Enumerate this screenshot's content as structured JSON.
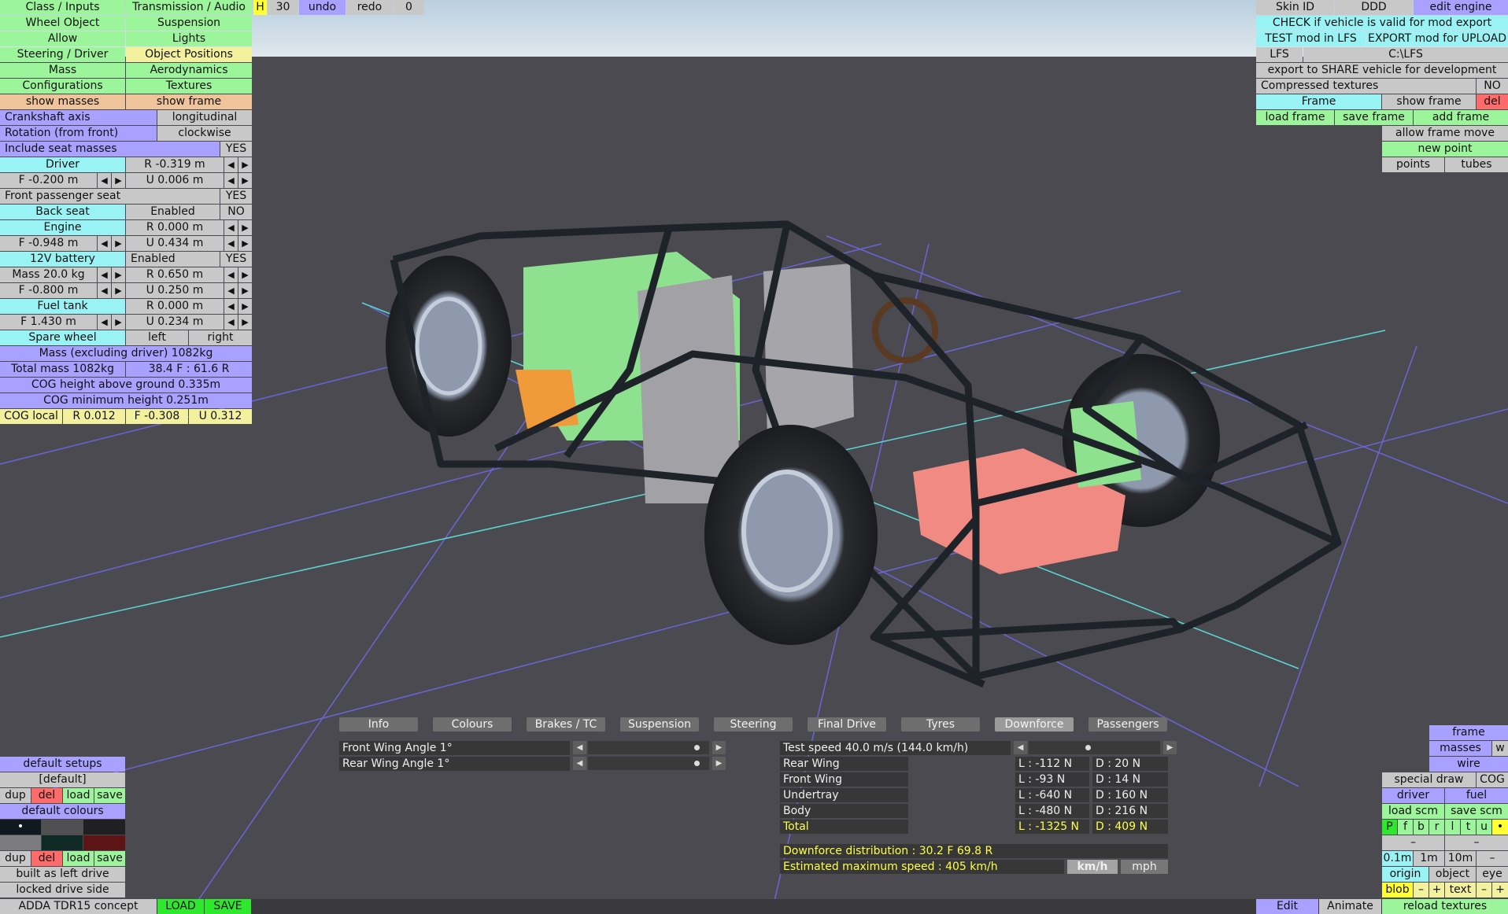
{
  "left_panel": {
    "nav": [
      "Class / Inputs",
      "Transmission / Audio",
      "Wheel Object",
      "Suspension",
      "Allow",
      "Lights",
      "Steering / Driver",
      "Object Positions",
      "Mass",
      "Aerodynamics",
      "Configurations",
      "Textures",
      "show masses",
      "show frame"
    ],
    "crankshaft_label": "Crankshaft axis",
    "crankshaft_value": "longitudinal",
    "rotation_label": "Rotation (from front)",
    "rotation_value": "clockwise",
    "seat_masses_label": "Include seat masses",
    "seat_masses_value": "YES",
    "driver_label": "Driver",
    "driver_r": "R -0.319 m",
    "driver_f": "F -0.200 m",
    "driver_u": "U 0.006 m",
    "front_passenger_label": "Front passenger seat",
    "front_passenger_value": "YES",
    "back_seat_label": "Back seat",
    "back_seat_state": "Enabled",
    "back_seat_value": "NO",
    "engine_label": "Engine",
    "engine_r": "R 0.000 m",
    "engine_f": "F -0.948 m",
    "engine_u": "U 0.434 m",
    "battery_label": "12V battery",
    "battery_state": "Enabled",
    "battery_value": "YES",
    "battery_mass": "Mass 20.0 kg",
    "battery_r": "R 0.650 m",
    "battery_f": "F -0.800 m",
    "battery_u": "U 0.250 m",
    "fuel_label": "Fuel tank",
    "fuel_r": "R 0.000 m",
    "fuel_f": "F 1.430 m",
    "fuel_u": "U 0.234 m",
    "spare_label": "Spare wheel",
    "spare_left": "left",
    "spare_right": "right",
    "mass_excl": "Mass (excluding driver) 1082kg",
    "total_mass": "Total mass 1082kg",
    "distribution": "38.4 F : 61.6 R",
    "cog_height": "COG height above ground 0.335m",
    "cog_min": "COG minimum height 0.251m",
    "cog_local": "COG local",
    "cog_r": "R 0.012",
    "cog_f": "F -0.308",
    "cog_u": "U 0.312"
  },
  "top_toolbar": {
    "h": "H",
    "num": "30",
    "undo": "undo",
    "redo": "redo",
    "count": "0"
  },
  "right_panel": {
    "skin_id": "Skin ID",
    "ddd": "DDD",
    "edit_engine": "edit engine",
    "check_valid": "CHECK if vehicle is valid for mod export",
    "test_mod": "TEST mod in LFS",
    "export_mod": "EXPORT mod for UPLOAD",
    "lfs": "LFS",
    "lfs_path": "C:\\LFS",
    "export_share": "export to SHARE vehicle for development",
    "compressed": "Compressed textures",
    "compressed_value": "NO",
    "frame": "Frame",
    "show_frame": "show frame",
    "del": "del",
    "load_frame": "load frame",
    "save_frame": "save frame",
    "add_frame": "add frame",
    "allow_move": "allow frame move",
    "new_point": "new point",
    "points": "points",
    "tubes": "tubes"
  },
  "bottom_left": {
    "default_setups": "default setups",
    "default_item": "[default]",
    "dup": "dup",
    "del": "del",
    "load": "load",
    "save": "save",
    "default_colours": "default colours",
    "dot": "•",
    "built_as": "built as left drive",
    "locked": "locked drive side",
    "car_name": "ADDA TDR15 concept",
    "load_btn": "LOAD",
    "save_btn": "SAVE"
  },
  "bottom_right": {
    "frame": "frame",
    "masses": "masses",
    "w": "w",
    "wire": "wire",
    "special_draw": "special draw",
    "cog": "COG",
    "driver": "driver",
    "fuel": "fuel",
    "load_scm": "load scm",
    "save_scm": "save scm",
    "letters": [
      "P",
      "f",
      "b",
      "r",
      "l",
      "t",
      "u"
    ],
    "dot": "•",
    "dash": "–",
    "s01": "0.1m",
    "s1": "1m",
    "s10": "10m",
    "origin": "origin",
    "object": "object",
    "eye": "eye",
    "blob": "blob",
    "minus": "–",
    "plus": "+",
    "text": "text",
    "edit": "Edit",
    "animate": "Animate",
    "reload": "reload textures"
  },
  "tabs": [
    "Info",
    "Colours",
    "Brakes / TC",
    "Suspension",
    "Steering",
    "Final Drive",
    "Tyres",
    "Downforce",
    "Passengers"
  ],
  "active_tab": "Downforce",
  "wings": {
    "front": "Front Wing Angle 1°",
    "rear": "Rear Wing Angle 1°",
    "front_level": 0.92,
    "rear_level": 0.92
  },
  "downforce": {
    "test_speed": "Test speed 40.0 m/s (144.0 km/h)",
    "test_speed_level": 0.45,
    "rows": [
      {
        "name": "Rear Wing",
        "l": "L : -112 N",
        "d": "D : 20 N"
      },
      {
        "name": "Front Wing",
        "l": "L : -93 N",
        "d": "D : 14 N"
      },
      {
        "name": "Undertray",
        "l": "L : -640 N",
        "d": "D : 160 N"
      },
      {
        "name": "Body",
        "l": "L : -480 N",
        "d": "D : 216 N"
      },
      {
        "name": "Total",
        "l": "L : -1325 N",
        "d": "D : 409 N"
      }
    ],
    "distribution": "Downforce distribution : 30.2 F  69.8 R",
    "max_speed": "Estimated maximum speed : 405 km/h",
    "kmh": "km/h",
    "mph": "mph"
  },
  "colors": {
    "green": "#9cf59a",
    "cyan": "#99f3f5",
    "purple": "#a9a1ff",
    "yellow": "#f3f19e",
    "orange": "#f0c49a",
    "red": "#ff6a6a"
  }
}
